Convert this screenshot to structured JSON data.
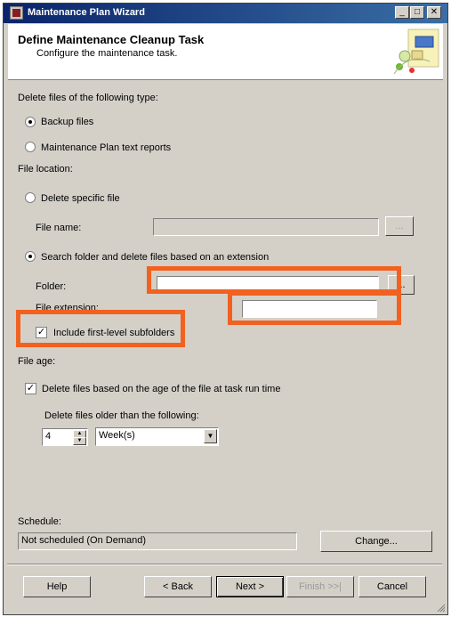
{
  "window": {
    "title": "Maintenance Plan Wizard",
    "controls": [
      "minimize",
      "maximize",
      "close"
    ]
  },
  "header": {
    "title": "Define Maintenance Cleanup Task",
    "subtitle": "Configure the maintenance task.",
    "icon": "wizard-graphic-icon"
  },
  "delete_type": {
    "label": "Delete files of the following type:",
    "options": [
      {
        "label": "Backup files",
        "selected": true
      },
      {
        "label": "Maintenance Plan text reports",
        "selected": false
      }
    ]
  },
  "file_location": {
    "label": "File location:",
    "delete_specific_label": "Delete specific file",
    "delete_specific_selected": false,
    "file_name_label": "File name:",
    "file_name_value": "",
    "browse_label": "...",
    "search_folder_label": "Search folder and delete files based on an extension",
    "search_folder_selected": true,
    "folder_label": "Folder:",
    "folder_value": "",
    "file_extension_label": "File extension:",
    "file_extension_value": "",
    "include_subfolders_label": "Include first-level subfolders",
    "include_subfolders_checked": true
  },
  "file_age": {
    "label": "File age:",
    "delete_by_age_label": "Delete files based on the age of the file at task run time",
    "delete_by_age_checked": true,
    "older_than_label": "Delete files older than the following:",
    "amount_value": "4",
    "unit_value": "Week(s)"
  },
  "schedule": {
    "label": "Schedule:",
    "value": "Not scheduled (On Demand)",
    "change_label": "Change..."
  },
  "buttons": {
    "help": "Help",
    "back": "< Back",
    "next": "Next >",
    "finish": "Finish >>|",
    "cancel": "Cancel"
  },
  "colors": {
    "highlight": "#f26120",
    "dialog_bg": "#d4d0c8",
    "titlebar": "#0a246a"
  }
}
